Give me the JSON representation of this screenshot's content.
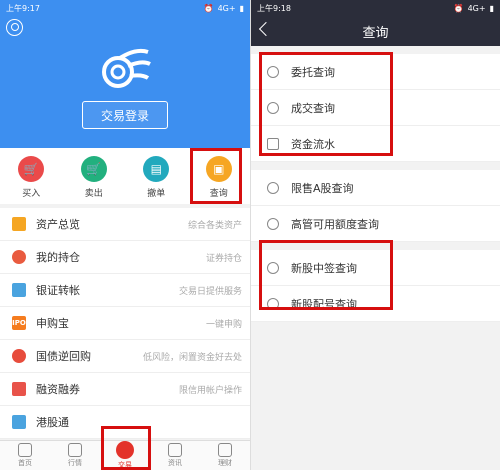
{
  "left": {
    "status": {
      "time": "上午9:17",
      "network": "4G+"
    },
    "login_button": "交易登录",
    "quick_actions": [
      {
        "label": "买入",
        "color": "#ea4a4a",
        "icon": "cart-icon"
      },
      {
        "label": "卖出",
        "color": "#22b07e",
        "icon": "cart-icon"
      },
      {
        "label": "撤单",
        "color": "#22a9bd",
        "icon": "document-icon"
      },
      {
        "label": "查询",
        "color": "#f6a623",
        "icon": "search-document-icon"
      }
    ],
    "menu": [
      {
        "label": "资产总览",
        "desc": "综合各类资产",
        "color": "#f5a623",
        "icon": "wallet-icon",
        "glyph": ""
      },
      {
        "label": "我的持仓",
        "desc": "证券持仓",
        "color": "#e95b3f",
        "icon": "user-icon",
        "glyph": ""
      },
      {
        "label": "银证转帐",
        "desc": "交易日提供服务",
        "color": "#4aa3df",
        "icon": "card-icon",
        "glyph": ""
      },
      {
        "label": "申购宝",
        "desc": "一键申购",
        "color": "#f57c1f",
        "icon": "ipo-icon",
        "glyph": "IPO"
      },
      {
        "label": "国债逆回购",
        "desc": "低风险，闲置资金好去处",
        "color": "#e74c3c",
        "icon": "coin-icon",
        "glyph": ""
      },
      {
        "label": "融资融券",
        "desc": "限信用帐户操作",
        "color": "#e8534a",
        "icon": "chart-icon",
        "glyph": ""
      },
      {
        "label": "港股通",
        "desc": "",
        "color": "#4aa3df",
        "icon": "hk-icon",
        "glyph": ""
      }
    ],
    "tabs": [
      {
        "label": "首页",
        "icon": "home-icon"
      },
      {
        "label": "行情",
        "icon": "trend-icon"
      },
      {
        "label": "交易",
        "icon": "trade-icon"
      },
      {
        "label": "资讯",
        "icon": "news-icon"
      },
      {
        "label": "理财",
        "icon": "finance-icon"
      }
    ]
  },
  "right": {
    "status": {
      "time": "上午9:18",
      "network": "4G+"
    },
    "title": "查询",
    "groups": [
      [
        {
          "label": "委托查询",
          "icon": "entrust-icon"
        },
        {
          "label": "成交查询",
          "icon": "deal-icon"
        },
        {
          "label": "资金流水",
          "icon": "money-flow-icon"
        }
      ],
      [
        {
          "label": "限售A股查询",
          "icon": "a-share-icon"
        },
        {
          "label": "高管可用额度查询",
          "icon": "quota-icon"
        }
      ],
      [
        {
          "label": "新股中签查询",
          "icon": "lottery-icon"
        },
        {
          "label": "新股配号查询",
          "icon": "allot-icon"
        }
      ]
    ]
  },
  "colors": {
    "blue": "#3d8ff0",
    "dark": "#2b2d3a",
    "highlight": "#d60f0f"
  }
}
